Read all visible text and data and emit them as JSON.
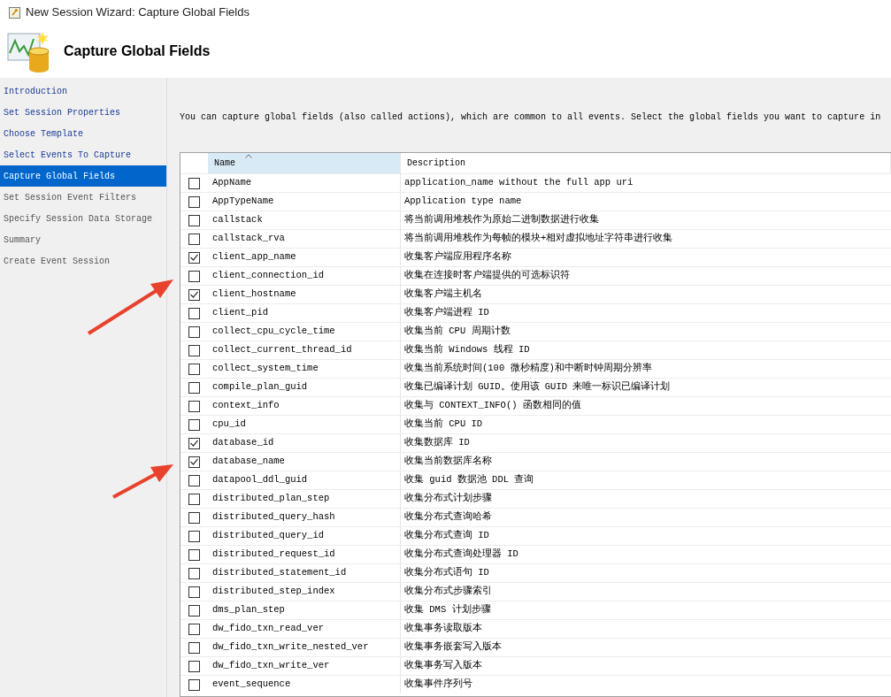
{
  "window": {
    "title": "New Session Wizard: Capture Global Fields"
  },
  "header": {
    "title": "Capture Global Fields"
  },
  "sidebar": {
    "items": [
      {
        "label": "Introduction",
        "visited": true,
        "selected": false
      },
      {
        "label": "Set Session Properties",
        "visited": true,
        "selected": false
      },
      {
        "label": "Choose Template",
        "visited": true,
        "selected": false
      },
      {
        "label": "Select Events To Capture",
        "visited": true,
        "selected": false
      },
      {
        "label": "Capture Global Fields",
        "visited": false,
        "selected": true
      },
      {
        "label": "Set Session Event Filters",
        "visited": false,
        "selected": false
      },
      {
        "label": "Specify Session Data Storage",
        "visited": false,
        "selected": false
      },
      {
        "label": "Summary",
        "visited": false,
        "selected": false
      },
      {
        "label": "Create Event Session",
        "visited": false,
        "selected": false
      }
    ]
  },
  "instructions": "You can capture global fields (also called actions), which are common to all events. Select the global fields you want to capture in",
  "table": {
    "columns": [
      {
        "label": "Name",
        "sorted": true
      },
      {
        "label": "Description",
        "sorted": false
      }
    ],
    "rows": [
      {
        "name": "AppName",
        "description": "application_name without the full app uri",
        "checked": false
      },
      {
        "name": "AppTypeName",
        "description": "Application type name",
        "checked": false
      },
      {
        "name": "callstack",
        "description": "将当前调用堆栈作为原始二进制数据进行收集",
        "checked": false
      },
      {
        "name": "callstack_rva",
        "description": "将当前调用堆栈作为每帧的模块+相对虚拟地址字符串进行收集",
        "checked": false
      },
      {
        "name": "client_app_name",
        "description": "收集客户端应用程序名称",
        "checked": true
      },
      {
        "name": "client_connection_id",
        "description": "收集在连接时客户端提供的可选标识符",
        "checked": false
      },
      {
        "name": "client_hostname",
        "description": "收集客户端主机名",
        "checked": true
      },
      {
        "name": "client_pid",
        "description": "收集客户端进程 ID",
        "checked": false
      },
      {
        "name": "collect_cpu_cycle_time",
        "description": "收集当前 CPU 周期计数",
        "checked": false
      },
      {
        "name": "collect_current_thread_id",
        "description": "收集当前 Windows 线程 ID",
        "checked": false
      },
      {
        "name": "collect_system_time",
        "description": "收集当前系统时间(100 微秒精度)和中断时钟周期分辨率",
        "checked": false
      },
      {
        "name": "compile_plan_guid",
        "description": "收集已编译计划 GUID。使用该 GUID 来唯一标识已编译计划",
        "checked": false
      },
      {
        "name": "context_info",
        "description": "收集与 CONTEXT_INFO() 函数相同的值",
        "checked": false
      },
      {
        "name": "cpu_id",
        "description": "收集当前 CPU ID",
        "checked": false
      },
      {
        "name": "database_id",
        "description": "收集数据库 ID",
        "checked": true
      },
      {
        "name": "database_name",
        "description": "收集当前数据库名称",
        "checked": true
      },
      {
        "name": "datapool_ddl_guid",
        "description": "收集 guid 数据池 DDL 查询",
        "checked": false
      },
      {
        "name": "distributed_plan_step",
        "description": "收集分布式计划步骤",
        "checked": false
      },
      {
        "name": "distributed_query_hash",
        "description": "收集分布式查询哈希",
        "checked": false
      },
      {
        "name": "distributed_query_id",
        "description": "收集分布式查询 ID",
        "checked": false
      },
      {
        "name": "distributed_request_id",
        "description": "收集分布式查询处理器 ID",
        "checked": false
      },
      {
        "name": "distributed_statement_id",
        "description": "收集分布式语句 ID",
        "checked": false
      },
      {
        "name": "distributed_step_index",
        "description": "收集分布式步骤索引",
        "checked": false
      },
      {
        "name": "dms_plan_step",
        "description": "收集 DMS 计划步骤",
        "checked": false
      },
      {
        "name": "dw_fido_txn_read_ver",
        "description": "收集事务读取版本",
        "checked": false
      },
      {
        "name": "dw_fido_txn_write_nested_ver",
        "description": "收集事务嵌套写入版本",
        "checked": false
      },
      {
        "name": "dw_fido_txn_write_ver",
        "description": "收集事务写入版本",
        "checked": false
      },
      {
        "name": "event_sequence",
        "description": "收集事件序列号",
        "checked": false
      }
    ]
  }
}
